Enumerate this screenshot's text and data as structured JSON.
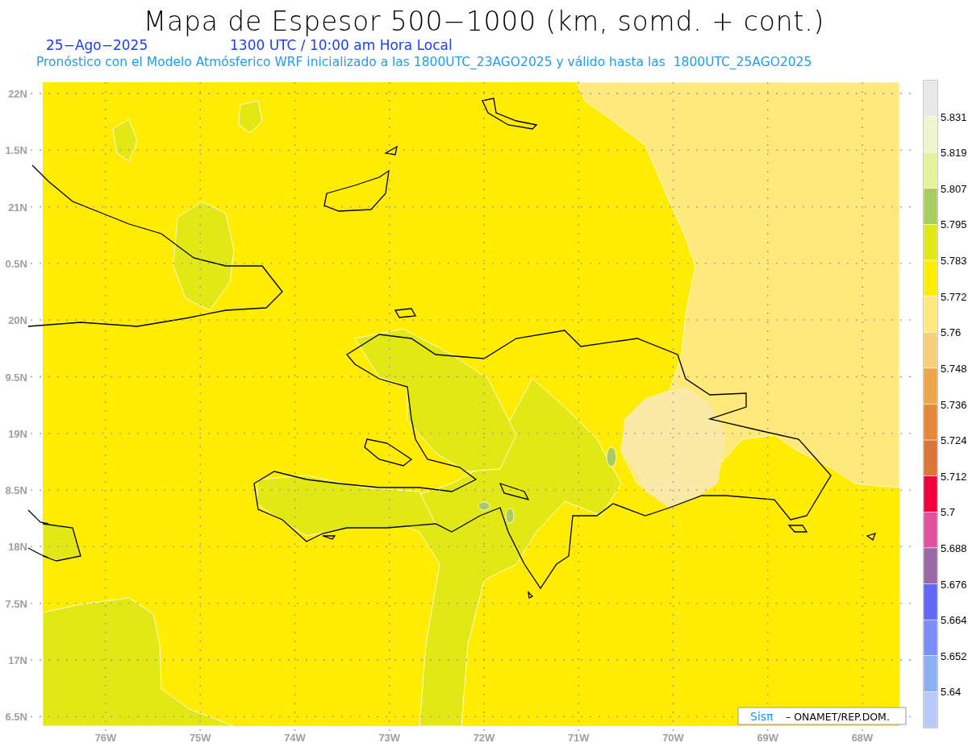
{
  "title": "Mapa de Espesor 500−1000 (km, somd. + cont.)",
  "date": "25−Ago−2025",
  "time_line": "1300 UTC / 10:00 am Hora Local",
  "forecast_line": "Pronóstico con el Modelo Atmósferico WRF inicializado a las 1800UTC_23AGO2025 y válido hasta las  1800UTC_25AGO2025",
  "lat_labels": [
    "22N",
    "1.5N",
    "21N",
    "0.5N",
    "20N",
    "9.5N",
    "19N",
    "8.5N",
    "18N",
    "7.5N",
    "17N",
    "6.5N"
  ],
  "lon_labels": [
    "76W",
    "75W",
    "74W",
    "73W",
    "72W",
    "71W",
    "70W",
    "69W",
    "68W"
  ],
  "colorbar": {
    "bins": [
      {
        "color": "#e8e8e8"
      },
      {
        "color": "#eef4cc"
      },
      {
        "color": "#e4f29a"
      },
      {
        "color": "#a9cc62"
      },
      {
        "color": "#e2e815"
      },
      {
        "color": "#ffec00"
      },
      {
        "color": "#ffe97c"
      },
      {
        "color": "#f5cf7a"
      },
      {
        "color": "#eda64a"
      },
      {
        "color": "#e48a3a"
      },
      {
        "color": "#d97638"
      },
      {
        "color": "#f0003c"
      },
      {
        "color": "#e450a0"
      },
      {
        "color": "#9a6aa8"
      },
      {
        "color": "#6466f8"
      },
      {
        "color": "#7c8cf8"
      },
      {
        "color": "#8cb0f8"
      },
      {
        "color": "#b8c8f8"
      }
    ],
    "labels": [
      "5.831",
      "5.819",
      "5.807",
      "5.795",
      "5.783",
      "5.772",
      "5.76",
      "5.748",
      "5.736",
      "5.724",
      "5.712",
      "5.7",
      "5.688",
      "5.676",
      "5.664",
      "5.652",
      "5.64"
    ]
  },
  "credit": {
    "brand": "Sisπ",
    "text": "– ONAMET/REP.DOM."
  }
}
